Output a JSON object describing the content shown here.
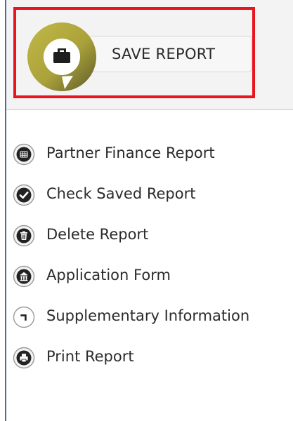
{
  "save_report": {
    "label": "SAVE REPORT",
    "icon": "briefcase-icon",
    "accent_color": "#b0a83c"
  },
  "menu": {
    "items": [
      {
        "label": "Partner Finance Report",
        "icon": "grid-icon"
      },
      {
        "label": "Check Saved Report",
        "icon": "check-circle-icon"
      },
      {
        "label": "Delete Report",
        "icon": "trash-icon"
      },
      {
        "label": "Application Form",
        "icon": "building-icon"
      },
      {
        "label": "Supplementary Information",
        "icon": "corner-arrow-icon"
      },
      {
        "label": "Print Report",
        "icon": "printer-icon"
      }
    ]
  },
  "colors": {
    "highlight": "#e8141e",
    "text": "#2b2b2b",
    "icon_dark": "#222222",
    "divider": "#4a6e9c"
  }
}
